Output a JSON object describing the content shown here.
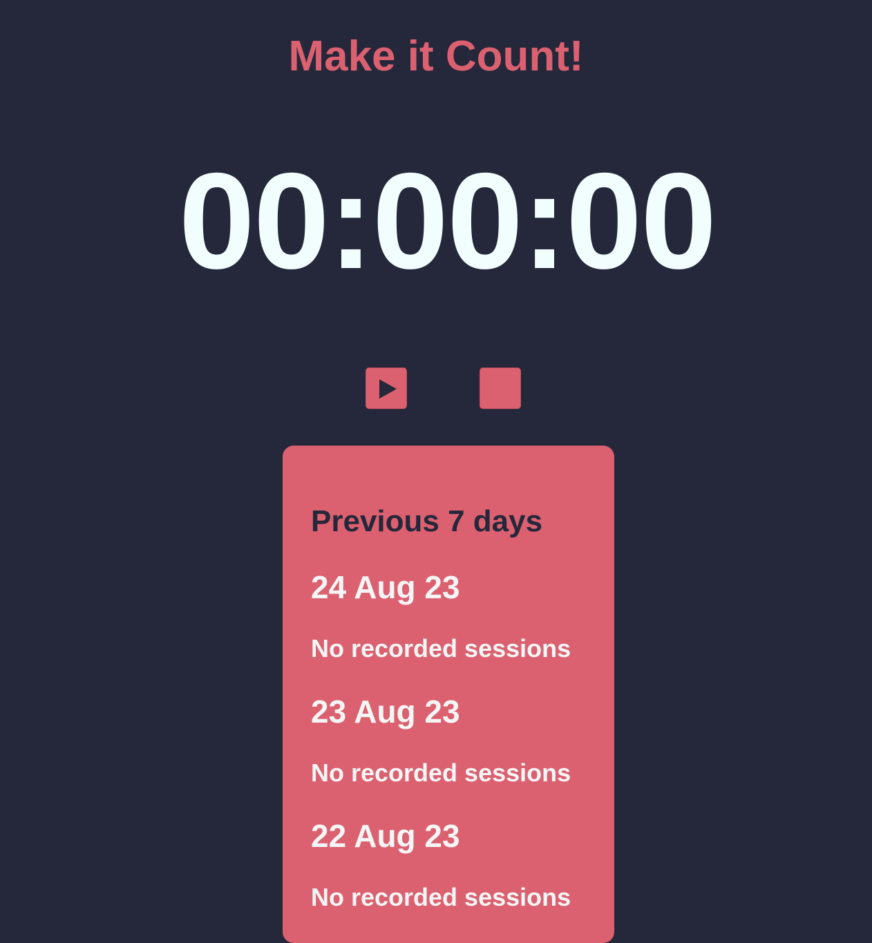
{
  "app": {
    "title": "Make it Count!"
  },
  "timer": {
    "display": "00:00:00"
  },
  "controls": {
    "play_icon": "play-icon",
    "stop_icon": "stop-icon"
  },
  "history": {
    "heading": "Previous 7 days",
    "days": [
      {
        "date": "24 Aug 23",
        "status": "No recorded sessions"
      },
      {
        "date": "23 Aug 23",
        "status": "No recorded sessions"
      },
      {
        "date": "22 Aug 23",
        "status": "No recorded sessions"
      }
    ]
  },
  "colors": {
    "background": "#25273a",
    "accent": "#db6170",
    "timer_text": "#f2fefe",
    "card_text": "#f4f6f6"
  }
}
